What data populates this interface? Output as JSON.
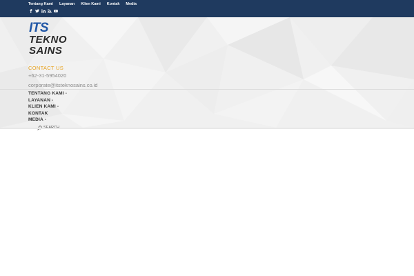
{
  "topbar": {
    "bg_color": "#1f3a5f",
    "nav": [
      "Tentang Kami",
      "Layanan",
      "Klien Kami",
      "Kontak",
      "Media"
    ],
    "social_icons": [
      "facebook-icon",
      "twitter-icon",
      "linkedin-icon",
      "rss-icon",
      "youtube-icon"
    ]
  },
  "logo": {
    "line1": "ITS",
    "line2": "TEKNO",
    "line3": "SAINS"
  },
  "contact": {
    "title": "CONTACT US",
    "phone": "+62-31-5954020",
    "email": "corporate@itsteknosains.co.id"
  },
  "mainnav": [
    "TENTANG KAMI -",
    "LAYANAN -",
    "KLIEN KAMI -",
    "KONTAK",
    "MEDIA -"
  ],
  "search": {
    "placeholder": "SEARCH"
  },
  "colors": {
    "accent": "#e8a21e",
    "logo_blue": "#2157a6"
  }
}
